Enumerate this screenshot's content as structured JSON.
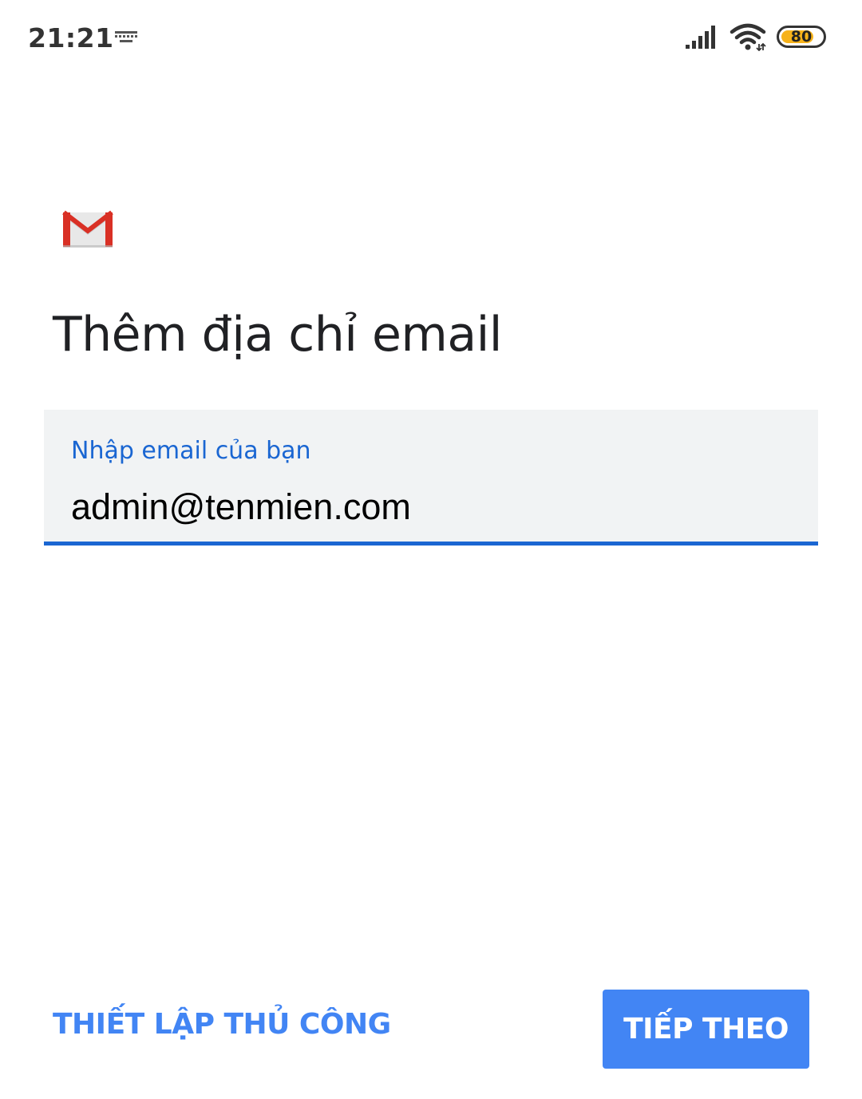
{
  "status_bar": {
    "time": "21:21",
    "battery_level": "80",
    "battery_fraction": 0.8,
    "icons": [
      "keyboard-icon",
      "signal-icon",
      "wifi-icon",
      "battery-icon"
    ]
  },
  "app": {
    "logo_icon": "gmail-icon",
    "title": "Thêm địa chỉ email"
  },
  "email_input": {
    "label": "Nhập email của bạn",
    "value": "admin@tenmien.com"
  },
  "actions": {
    "manual_setup_label": "THIẾT LẬP THỦ CÔNG",
    "next_label": "TIẾP THEO"
  },
  "colors": {
    "accent": "#4285f4",
    "input_underline": "#1a66d2",
    "input_background": "#f1f3f4",
    "battery": "#f6b21a",
    "gmail_red": "#d93025"
  }
}
